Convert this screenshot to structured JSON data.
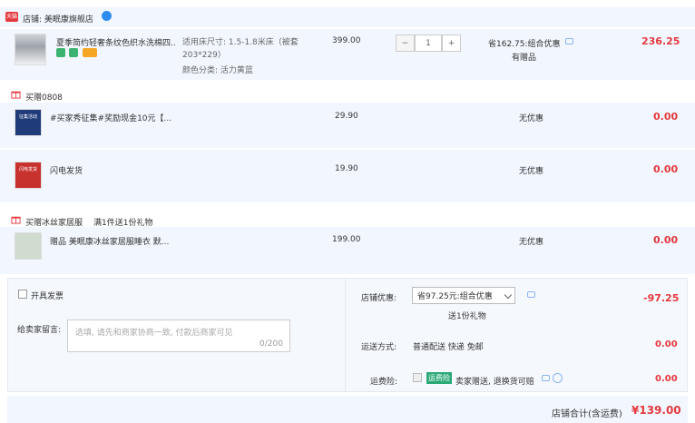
{
  "shop": {
    "badge": "天猫",
    "label": "店铺: 美眠康旗舰店"
  },
  "main_item": {
    "title": "夏季简约轻奢条纹色织水洗棉四...",
    "spec_size": "适用床尺寸: 1.5-1.8米床（被套203*229）",
    "spec_color": "颜色分类: 活力黄蓝",
    "price": "399.00",
    "qty": "1",
    "discount": "省162.75:组合优惠",
    "has_gift": "有赠品",
    "total": "236.25",
    "minus_glyph": "−",
    "plus_glyph": "+"
  },
  "gift_group_1": {
    "title": "买赠0808",
    "items": [
      {
        "title": "#买家秀征集#奖励现金10元【...",
        "price": "29.90",
        "discount": "无优惠",
        "total": "0.00",
        "thumb_text": "征集活动"
      },
      {
        "title": "闪电发货",
        "price": "19.90",
        "discount": "无优惠",
        "total": "0.00",
        "thumb_text": "闪电发货"
      }
    ]
  },
  "gift_group_2": {
    "title": "买赠冰丝家居服",
    "subtitle": "满1件送1份礼物",
    "item": {
      "title": "赠品 美眠康冰丝家居服睡衣 默...",
      "price": "199.00",
      "discount": "无优惠",
      "total": "0.00"
    }
  },
  "invoice": {
    "label": "开具发票"
  },
  "message": {
    "label": "给卖家留言:",
    "placeholder": "选填, 请先和商家协商一致, 付款后商家可见",
    "counter": "0/200"
  },
  "shop_discount": {
    "label": "店铺优惠:",
    "selected": "省97.25元:组合优惠",
    "gift_note": "送1份礼物",
    "value": "-97.25"
  },
  "shipping": {
    "label": "运送方式:",
    "value": "普通配送 快递 免邮",
    "amount": "0.00"
  },
  "insurance": {
    "label": "运费险:",
    "badge": "运费险",
    "desc": "卖家赠送, 退换货可赔",
    "amount": "0.00"
  },
  "footer": {
    "label": "店铺合计(含运费)",
    "total": "¥139.00"
  },
  "colors": {
    "accent_red": "#e4393c",
    "panel_blue": "#f2f7ff"
  }
}
